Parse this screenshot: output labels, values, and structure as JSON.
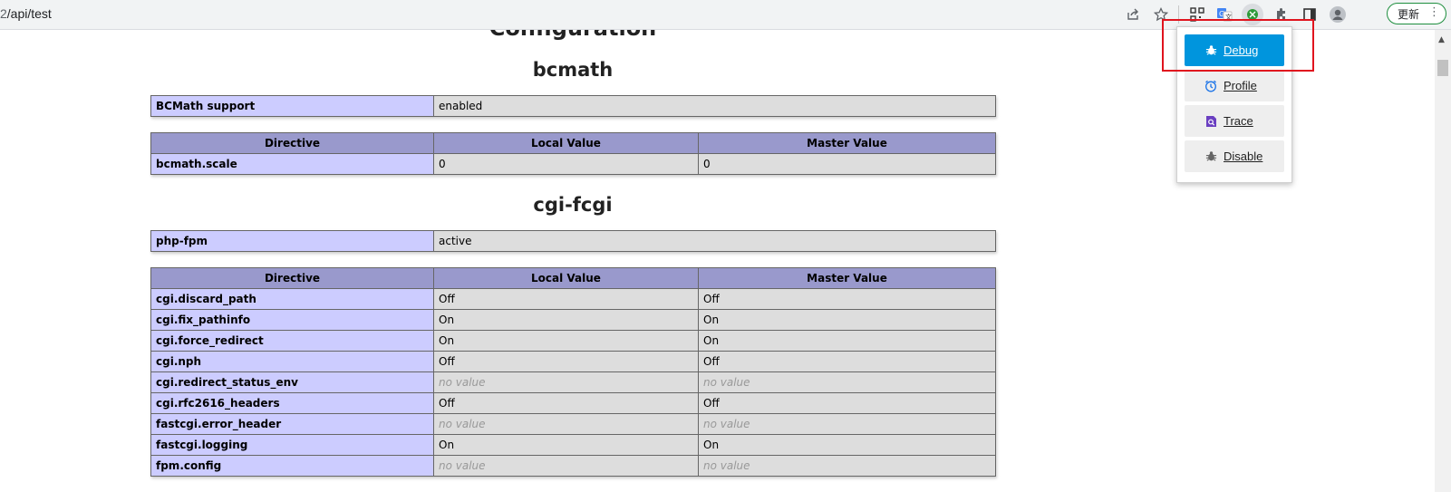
{
  "browser": {
    "url": "/api/test",
    "update_label": "更新"
  },
  "page": {
    "partial_title": "Configuration",
    "bcmath": {
      "heading": "bcmath",
      "support_label": "BCMath support",
      "support_value": "enabled",
      "headers": [
        "Directive",
        "Local Value",
        "Master Value"
      ],
      "rows": [
        {
          "directive": "bcmath.scale",
          "local": "0",
          "master": "0"
        }
      ]
    },
    "cgi_fcgi": {
      "heading": "cgi-fcgi",
      "fpm_label": "php-fpm",
      "fpm_value": "active",
      "headers": [
        "Directive",
        "Local Value",
        "Master Value"
      ],
      "rows": [
        {
          "directive": "cgi.discard_path",
          "local": "Off",
          "master": "Off"
        },
        {
          "directive": "cgi.fix_pathinfo",
          "local": "On",
          "master": "On"
        },
        {
          "directive": "cgi.force_redirect",
          "local": "On",
          "master": "On"
        },
        {
          "directive": "cgi.nph",
          "local": "Off",
          "master": "Off"
        },
        {
          "directive": "cgi.redirect_status_env",
          "local": "no value",
          "master": "no value"
        },
        {
          "directive": "cgi.rfc2616_headers",
          "local": "Off",
          "master": "Off"
        },
        {
          "directive": "fastcgi.error_header",
          "local": "no value",
          "master": "no value"
        },
        {
          "directive": "fastcgi.logging",
          "local": "On",
          "master": "On"
        },
        {
          "directive": "fpm.config",
          "local": "no value",
          "master": "no value"
        }
      ]
    }
  },
  "popup": {
    "buttons": [
      {
        "label": "Debug",
        "icon": "bug-icon",
        "active": true
      },
      {
        "label": "Profile",
        "icon": "clock-icon",
        "active": false
      },
      {
        "label": "Trace",
        "icon": "trace-search-icon",
        "active": false
      },
      {
        "label": "Disable",
        "icon": "bug-icon",
        "active": false
      }
    ]
  },
  "colors": {
    "accent": "#0095dd",
    "highlight": "#e0141e",
    "table_header": "#9999cc",
    "table_key": "#ccccff",
    "table_value": "#dddddd"
  }
}
